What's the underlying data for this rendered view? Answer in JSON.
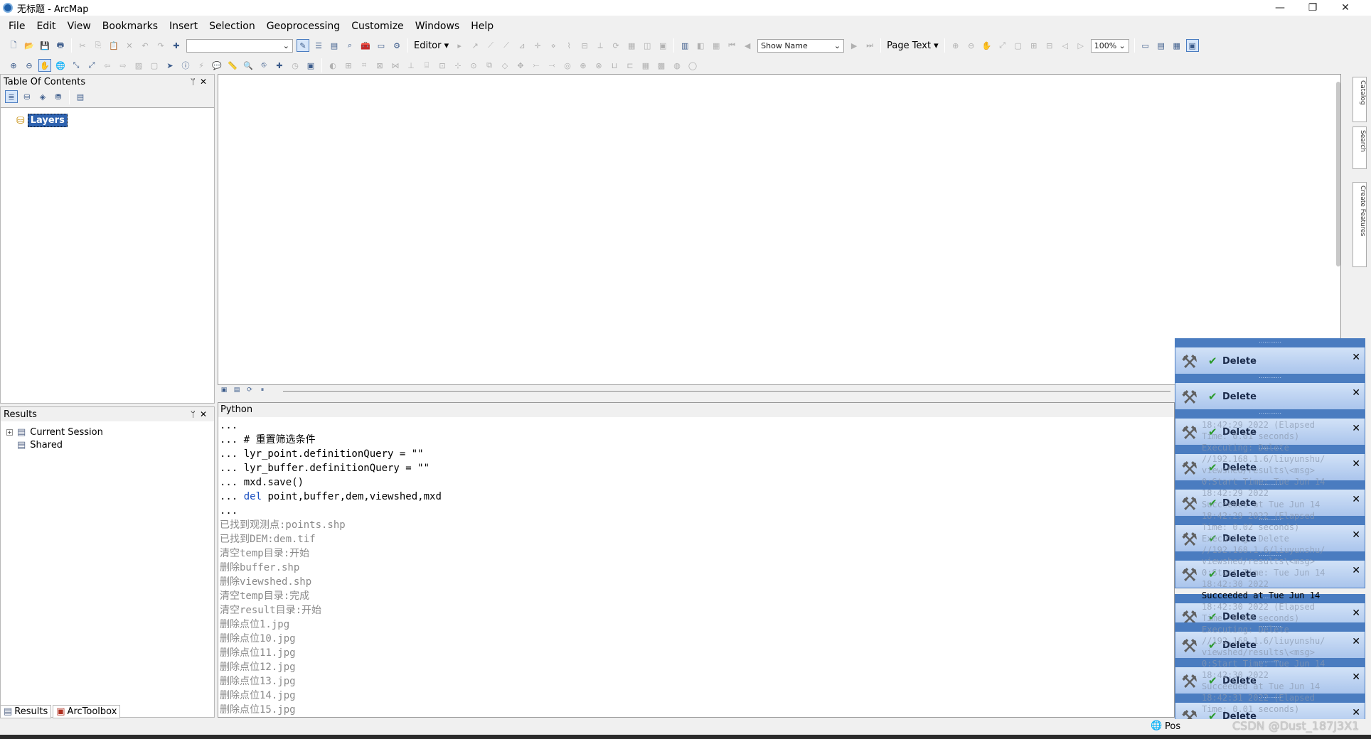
{
  "window": {
    "title": "无标题 - ArcMap",
    "minimize": "—",
    "restore": "❐",
    "close": "✕"
  },
  "menu": [
    "File",
    "Edit",
    "View",
    "Bookmarks",
    "Insert",
    "Selection",
    "Geoprocessing",
    "Customize",
    "Windows",
    "Help"
  ],
  "toolbar1": {
    "editor_label": "Editor ▾",
    "show_name": "Show Name",
    "page_text": "Page Text ▾",
    "zoom": "100%"
  },
  "toc": {
    "title": "Table Of Contents",
    "pin": "ᛘ",
    "close": "✕",
    "root_layer": "Layers"
  },
  "results": {
    "title": "Results",
    "pin": "ᛘ",
    "close": "✕",
    "items": [
      "Current Session",
      "Shared"
    ]
  },
  "tabs": {
    "results": "Results",
    "arctoolbox": "ArcToolbox"
  },
  "python": {
    "title": "Python",
    "lines": [
      {
        "type": "cmd",
        "text": "..."
      },
      {
        "type": "cmd",
        "text": "... # 重置筛选条件"
      },
      {
        "type": "cmd",
        "text": "... lyr_point.definitionQuery = \"\""
      },
      {
        "type": "cmd",
        "text": "... lyr_buffer.definitionQuery = \"\""
      },
      {
        "type": "cmd",
        "text": "... mxd.save()"
      },
      {
        "type": "kwline",
        "prefix": "... ",
        "kw": "del",
        "rest": " point,buffer,dem,viewshed,mxd"
      },
      {
        "type": "cmd",
        "text": "..."
      },
      {
        "type": "out",
        "text": "已找到观测点:points.shp"
      },
      {
        "type": "out",
        "text": "已找到DEM:dem.tif"
      },
      {
        "type": "out",
        "text": "清空temp目录:开始"
      },
      {
        "type": "out",
        "text": "删除buffer.shp"
      },
      {
        "type": "out",
        "text": "删除viewshed.shp"
      },
      {
        "type": "out",
        "text": "清空temp目录:完成"
      },
      {
        "type": "out",
        "text": "清空result目录:开始"
      },
      {
        "type": "out",
        "text": "删除点位1.jpg"
      },
      {
        "type": "out",
        "text": "删除点位10.jpg"
      },
      {
        "type": "out",
        "text": "删除点位11.jpg"
      },
      {
        "type": "out",
        "text": "删除点位12.jpg"
      },
      {
        "type": "out",
        "text": "删除点位13.jpg"
      },
      {
        "type": "out",
        "text": "删除点位14.jpg"
      },
      {
        "type": "out",
        "text": "删除点位15.jpg"
      }
    ]
  },
  "notifications": {
    "title": "Delete",
    "count": 11,
    "ghost_text": [
      "18:42:29 2022 (Elapsed\nTime: 0.01 seconds)\nExecuting: Delete\n//192.168.1.6/liuyunshu/\nviewshed/results\\<msg>\n0:Start Time: Tue Jun 14\n18:42:29 2022\nSucceeded at Tue Jun 14\n18:42:29 2022 (Elapsed\nTime: 0.02 seconds)\nExecuting: Delete\n//192.168.1.6/liuyunshu/\nviewshed/results\\<msg>\n0:Start Time: Tue Jun 14\n18:42:30 2022",
      "Succeeded at Tue Jun 14",
      "18:42:30 2022 (Elapsed\nTime: 0.02 seconds)\nExecuting: Delete\n//192.168.1.6/liuyunshu/\nviewshed/results\\<msg>\n0:Start Time: Tue Jun 14\n18:42:30 2022\nSucceeded at Tue Jun 14\n18:42:31 2022 (Elapsed\nTime: 0.01 seconds)"
    ]
  },
  "status": {
    "pos": "Pos"
  },
  "watermark": "CSDN @Dust_187J3X1",
  "colors": {
    "notification_border": "#4a7cc0",
    "selected_layer": "#2f63b0",
    "keyword": "#1a4fc0"
  }
}
